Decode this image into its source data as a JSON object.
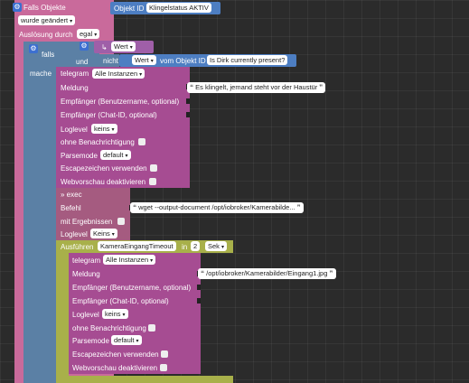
{
  "colors": {
    "event": "#c96a9b",
    "logic": "#5b80a5",
    "object": "#4d7ec2",
    "telegram": "#a64c92",
    "exec": "#a55b80",
    "timeout": "#a8b04a",
    "value": "#9f5fa8"
  },
  "trigger": {
    "title": "Falls Objekte",
    "object_label": "Objekt ID",
    "object_value": "Klingelstatus AKTIV",
    "change": "wurde geändert",
    "trigger_label": "Auslösung durch",
    "trigger_value": "egal"
  },
  "if_block": {
    "falls": "falls",
    "mache": "mache",
    "wert_value": "Wert",
    "und": "und",
    "nicht": "nicht",
    "wert2": "Wert",
    "vom_objekt": "vom Objekt ID",
    "object2": "Is Dirk currently present?"
  },
  "telegram1": {
    "title": "telegram",
    "instance": "Alle Instanzen",
    "meldung": "Meldung",
    "message": "Es klingelt, jemand steht vor der Haustür",
    "empfaenger": "Empfänger (Benutzername, optional)",
    "chatid": "Empfänger (Chat-ID, optional)",
    "loglevel": "Loglevel",
    "loglevel_value": "keins",
    "ohne": "ohne Benachrichtigung",
    "parsemode": "Parsemode",
    "parsemode_value": "default",
    "escape": "Escapezeichen verwenden",
    "webvorschau": "Webvorschau deaktivieren"
  },
  "exec": {
    "title": "» exec",
    "befehl": "Befehl",
    "command": "wget --output-document /opt/iobroker/Kamerabilde...",
    "ergebnisse": "mit Ergebnissen",
    "loglevel": "Loglevel",
    "loglevel_value": "Keins"
  },
  "timeout": {
    "label": "Ausführen",
    "name": "KameraEingangTimeout",
    "in": "in",
    "value": "2",
    "unit": "Sek"
  },
  "telegram2": {
    "title": "telegram",
    "instance": "Alle Instanzen",
    "meldung": "Meldung",
    "message": "/opt/iobroker/Kamerabilder/Eingang1.jpg",
    "empfaenger": "Empfänger (Benutzername, optional)",
    "chatid": "Empfänger (Chat-ID, optional)",
    "loglevel": "Loglevel",
    "loglevel_value": "keins",
    "ohne": "ohne Benachrichtigung",
    "parsemode": "Parsemode",
    "parsemode_value": "default",
    "escape": "Escapezeichen verwenden",
    "webvorschau": "Webvorschau deaktivieren"
  }
}
